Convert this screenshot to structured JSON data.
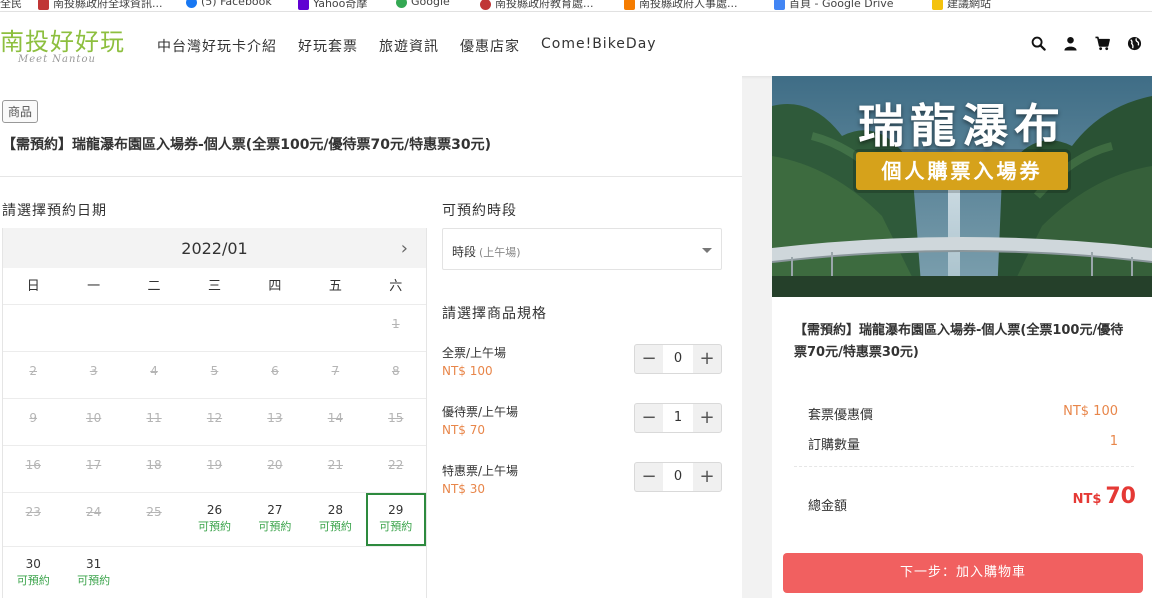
{
  "bookmarks": [
    {
      "label": "全民",
      "color": "#e8864a"
    },
    {
      "label": "南投縣政府全球資訊...",
      "color": "#c03636"
    },
    {
      "label": "(5) Facebook",
      "color": "#1877f2"
    },
    {
      "label": "Yahoo奇摩",
      "color": "#6001d2"
    },
    {
      "label": "Google",
      "color": "#34a853"
    },
    {
      "label": "南投縣政府教育處...",
      "color": "#c03636"
    },
    {
      "label": "南投縣政府人事處...",
      "color": "#f57c00"
    },
    {
      "label": "首頁 - Google Drive",
      "color": "#4285f4"
    },
    {
      "label": "建議網站",
      "color": "#f4c20d"
    }
  ],
  "header": {
    "logo_main": "南投好好玩",
    "logo_sub": "Meet Nantou",
    "nav": [
      "中台灣好玩卡介紹",
      "好玩套票",
      "旅遊資訊",
      "優惠店家",
      "Come!BikeDay"
    ]
  },
  "product": {
    "tag": "商品",
    "title": "【需預約】瑞龍瀑布園區入場券-個人票(全票100元/優待票70元/特惠票30元)"
  },
  "date_section": {
    "label": "請選擇預約日期",
    "month": "2022/01",
    "weekdays": [
      "日",
      "一",
      "二",
      "三",
      "四",
      "五",
      "六"
    ],
    "available_label": "可預約"
  },
  "time_section": {
    "label": "可預約時段",
    "selected": "時段",
    "selected_note": "(上午場)"
  },
  "spec_section": {
    "label": "請選擇商品規格",
    "items": [
      {
        "name": "全票/上午場",
        "price": "NT$ 100",
        "qty": "0"
      },
      {
        "name": "優待票/上午場",
        "price": "NT$ 70",
        "qty": "1"
      },
      {
        "name": "特惠票/上午場",
        "price": "NT$ 30",
        "qty": "0"
      }
    ],
    "minus": "−",
    "plus": "+"
  },
  "cart": {
    "banner_title": "瑞龍瀑布",
    "banner_badge": "個人購票入場券",
    "title": "【需預約】瑞龍瀑布園區入場券-個人票(全票100元/優待票70元/特惠票30元)",
    "price_label": "套票優惠價",
    "price_value": "NT$ 100",
    "qty_label": "訂購數量",
    "qty_value": "1",
    "total_label": "總金額",
    "total_currency": "NT$",
    "total_amount": "70",
    "next_button": "下一步：加入購物車"
  },
  "colors": {
    "accent_green": "#3aa34a",
    "price_orange": "#e8864a",
    "total_red": "#e53935",
    "button_red": "#f16060"
  }
}
